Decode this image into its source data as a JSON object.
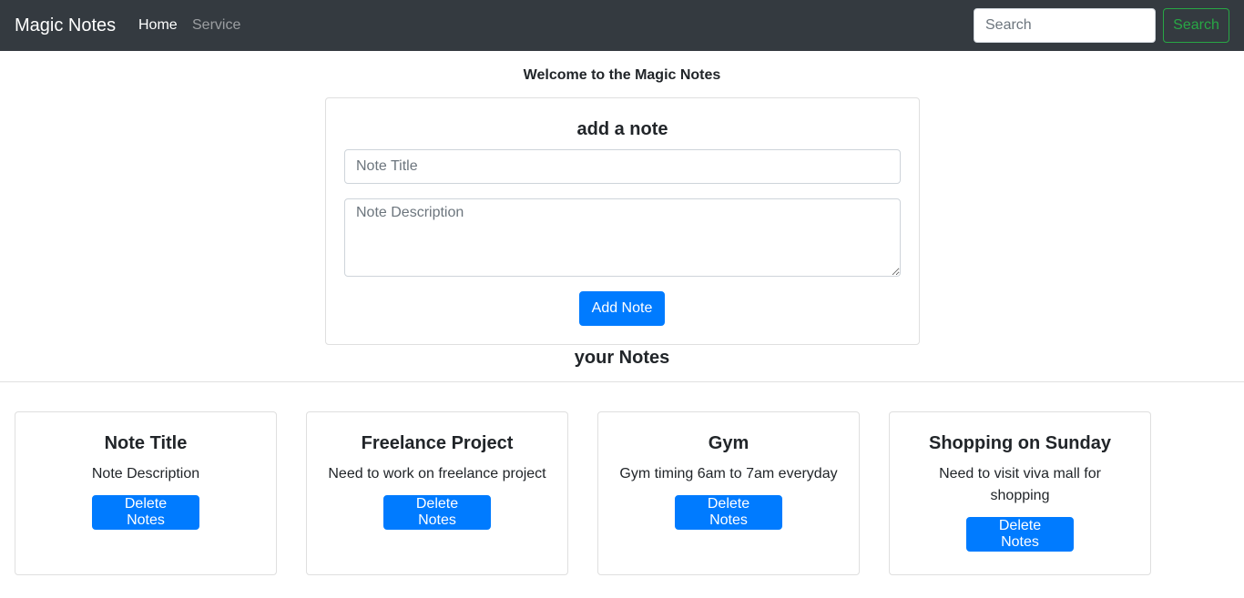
{
  "navbar": {
    "brand": "Magic Notes",
    "links": [
      {
        "label": "Home"
      },
      {
        "label": "Service"
      }
    ],
    "search_placeholder": "Search",
    "search_button": "Search"
  },
  "welcome": "Welcome to the Magic Notes",
  "add_note": {
    "heading": "add a note",
    "title_placeholder": "Note Title",
    "description_placeholder": "Note Description",
    "button": "Add Note"
  },
  "notes_heading": "your Notes",
  "notes": [
    {
      "title": "Note Title",
      "text": "Note Description",
      "button": "Delete Notes"
    },
    {
      "title": "Freelance Project",
      "text": "Need to work on freelance project",
      "button": "Delete Notes"
    },
    {
      "title": "Gym",
      "text": "Gym timing 6am to 7am everyday",
      "button": "Delete Notes"
    },
    {
      "title": "Shopping on Sunday",
      "text": "Need to visit viva mall for shopping",
      "button": "Delete Notes"
    }
  ],
  "colors": {
    "navbar_bg": "#343a40",
    "primary": "#007bff",
    "success": "#28a745"
  }
}
